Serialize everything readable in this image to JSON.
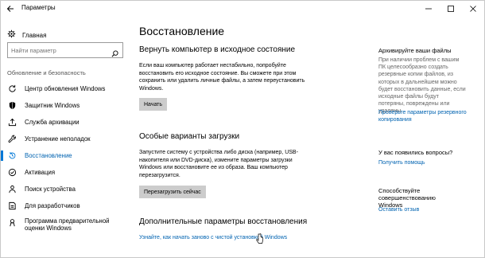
{
  "window": {
    "title": "Параметры"
  },
  "sidebar": {
    "home_label": "Главная",
    "search_placeholder": "Найти параметр",
    "section_label": "Обновление и безопасность",
    "items": [
      {
        "label": "Центр обновления Windows",
        "icon": "refresh-icon"
      },
      {
        "label": "Защитник Windows",
        "icon": "shield-icon"
      },
      {
        "label": "Служба архивации",
        "icon": "archive-upload-icon"
      },
      {
        "label": "Устранение неполадок",
        "icon": "wrench-icon"
      },
      {
        "label": "Восстановление",
        "icon": "history-icon",
        "active": true
      },
      {
        "label": "Активация",
        "icon": "activation-check-icon"
      },
      {
        "label": "Поиск устройства",
        "icon": "person-pin-icon"
      },
      {
        "label": "Для разработчиков",
        "icon": "developer-tools-icon"
      },
      {
        "label": "Программа предварительной оценки Windows",
        "icon": "insider-icon"
      }
    ]
  },
  "main": {
    "title": "Восстановление",
    "reset": {
      "heading": "Вернуть компьютер в исходное состояние",
      "text": "Если ваш компьютер работает нестабильно, попробуйте восстановить его исходное состояние. Вы сможете при этом сохранить или удалить личные файлы, а затем переустановить Windows.",
      "button": "Начать"
    },
    "advanced_startup": {
      "heading": "Особые варианты загрузки",
      "text": "Запустите систему с устройства либо диска (например, USB-накопителя или DVD-диска), измените параметры загрузки Windows или восстановите ее из образа. Ваш компьютер перезагрузится.",
      "button": "Перезагрузить сейчас"
    },
    "more_options": {
      "heading": "Дополнительные параметры восстановления",
      "link": "Узнайте, как начать заново с чистой установкой Windows"
    }
  },
  "right": {
    "backup": {
      "heading": "Архивируйте ваши файлы",
      "text": "При наличии проблем с вашим ПК целесообразно создать резервные копии файлов, из которых в дальнейшем можно будет восстановить данные, если исходные файлы будут потеряны, повреждены или удалены.",
      "link": "Проверьте параметры резервного копирования"
    },
    "question": {
      "heading": "У вас появились вопросы?",
      "link": "Получить помощь"
    },
    "improve": {
      "heading": "Способствуйте совершенствованию Windows",
      "link": "Оставить отзыв"
    }
  },
  "colors": {
    "accent": "#0078d7",
    "link": "#0063b1",
    "button": "#cccccc"
  }
}
